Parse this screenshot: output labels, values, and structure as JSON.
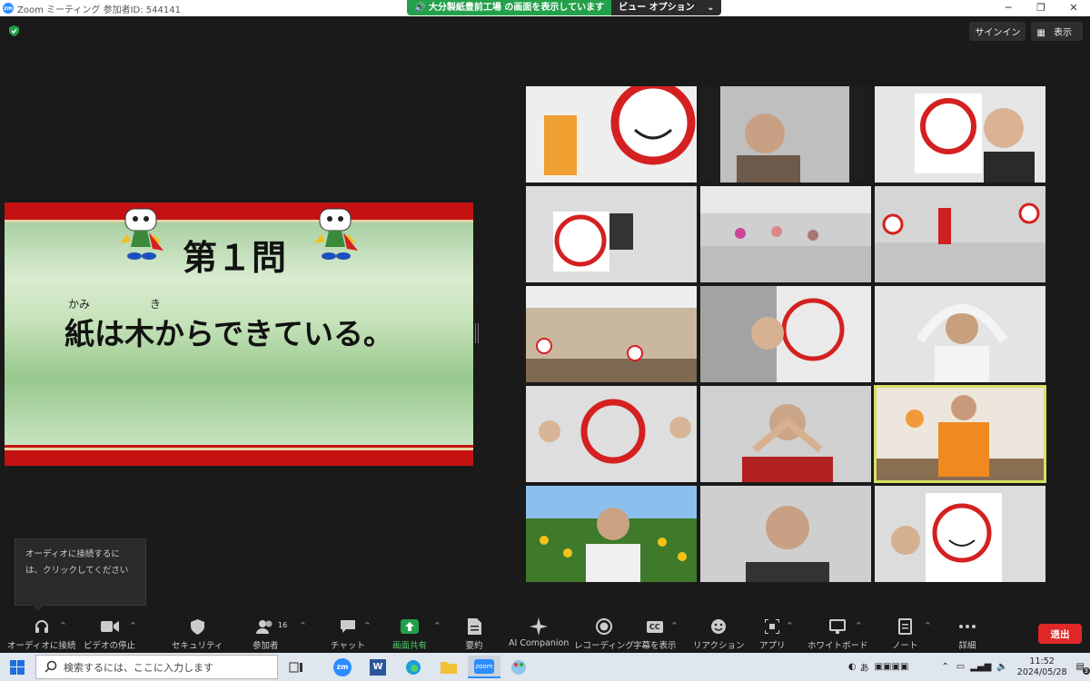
{
  "window": {
    "app_icon": "zm",
    "title": "Zoom ミーティング 参加者ID: 544141",
    "controls": [
      "─",
      "❐",
      "✕"
    ]
  },
  "share_banner": {
    "text": "大分製紙豊前工場 の画面を表示しています",
    "view_options": "ビュー オプション",
    "caret": "⌄"
  },
  "top_right": {
    "signin": "サインイン",
    "view": "表示"
  },
  "slide": {
    "title": "第１問",
    "ruby_kami": "かみ",
    "ruby_ki": "き",
    "text": "紙は木からできている。"
  },
  "tooltip": {
    "text": "オーディオに接続するには、クリックしてください"
  },
  "toolbar": {
    "items": [
      {
        "label": "オーディオに接続",
        "icon": "headphones-icon"
      },
      {
        "label": "ビデオの停止",
        "icon": "video-camera-icon"
      },
      {
        "label": "セキュリティ",
        "icon": "shield-icon"
      },
      {
        "label": "参加者",
        "icon": "participants-icon"
      },
      {
        "label": "チャット",
        "icon": "chat-icon"
      },
      {
        "label": "画面共有",
        "icon": "share-screen-icon"
      },
      {
        "label": "要約",
        "icon": "summary-icon"
      },
      {
        "label": "AI Companion",
        "icon": "sparkle-icon"
      },
      {
        "label": "レコーディング",
        "icon": "record-icon"
      },
      {
        "label": "字幕を表示",
        "icon": "captions-icon"
      },
      {
        "label": "リアクション",
        "icon": "reaction-icon"
      },
      {
        "label": "アプリ",
        "icon": "apps-icon"
      },
      {
        "label": "ホワイトボード",
        "icon": "whiteboard-icon"
      },
      {
        "label": "ノート",
        "icon": "notes-icon"
      },
      {
        "label": "詳細",
        "icon": "more-icon"
      }
    ],
    "participant_count": "16",
    "captions_badge": "CC",
    "caret": "^",
    "leave": "退出"
  },
  "taskbar": {
    "search_placeholder": "検索するには、ここに入力します",
    "ime": "あ",
    "time": "11:52",
    "date": "2024/05/28",
    "notification_count": "3",
    "zoom_icon_text": "zm",
    "word_icon_text": "W",
    "active_app_label": "zoom"
  },
  "colors": {
    "accent_green": "#23a04a",
    "leave_red": "#e02828",
    "active_speaker": "#d8e063",
    "slide_red": "#c41212"
  }
}
